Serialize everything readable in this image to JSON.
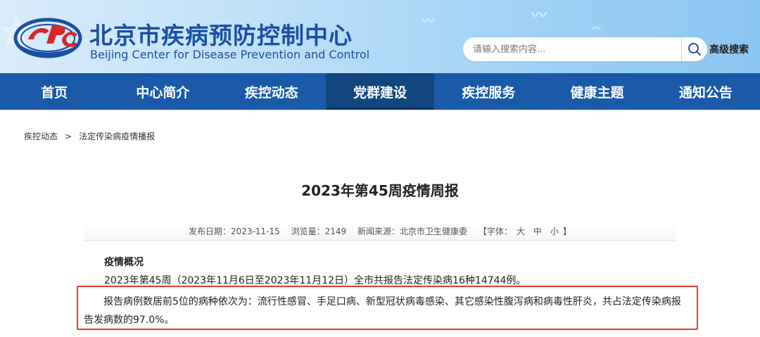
{
  "header": {
    "title_cn": "北京市疾病预防控制中心",
    "title_en": "Beijing Center for Disease Prevention and Control",
    "search": {
      "placeholder": "请输入搜索内容...",
      "value": ""
    },
    "advanced_search_label": "高级搜索"
  },
  "nav": {
    "items": [
      {
        "label": "首页",
        "active": false
      },
      {
        "label": "中心简介",
        "active": false
      },
      {
        "label": "疾控动态",
        "active": false
      },
      {
        "label": "党群建设",
        "active": true
      },
      {
        "label": "疾控服务",
        "active": false
      },
      {
        "label": "健康主题",
        "active": false
      },
      {
        "label": "通知公告",
        "active": false
      }
    ]
  },
  "breadcrumb": {
    "items": [
      "疾控动态",
      "法定传染病疫情播报"
    ],
    "separator": ">"
  },
  "article": {
    "title": "2023年第45周疫情周报",
    "meta": {
      "publish_date_label": "发布日期：",
      "publish_date": "2023-11-15",
      "views_label": "浏览量：",
      "views": "2149",
      "source_label": "新闻来源：",
      "source": "北京市卫生健康委",
      "font_label_open": "【字体：",
      "font_sizes": [
        "大",
        "中",
        "小"
      ],
      "font_label_close": "】"
    },
    "section_heading": "疫情概况",
    "paragraph_1": "2023年第45周（2023年11月6日至2023年11月12日）全市共报告法定传染病16种14744例。",
    "paragraph_2": "报告病例数居前5位的病种依次为：流行性感冒、手足口病、新型冠状病毒感染、其它感染性腹泻病和病毒性肝炎，共占法定传染病报告发病数的97.0%。"
  },
  "colors": {
    "brand_blue": "#1b4fa3",
    "nav_bg": "#1a5aa8",
    "nav_active_bg": "#13467f",
    "highlight_red": "#e63b32",
    "logo_red": "#d8262b"
  }
}
